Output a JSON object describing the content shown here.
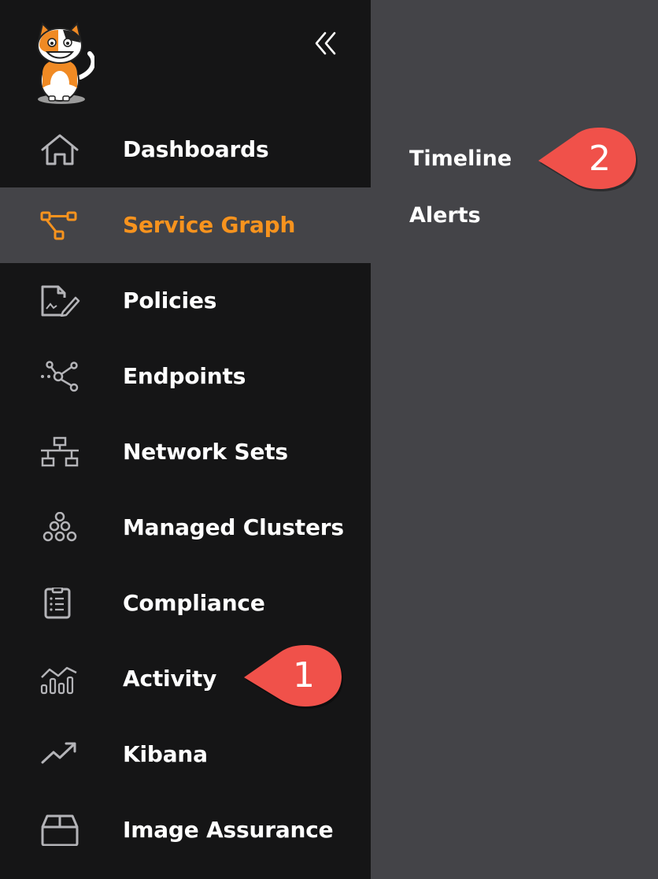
{
  "sidebar": {
    "collapse_icon": "double-chevron-left-icon",
    "logo_icon": "calico-cat-logo",
    "items": [
      {
        "label": "Dashboards",
        "icon": "home-icon"
      },
      {
        "label": "Service Graph",
        "icon": "service-graph-icon",
        "active": true
      },
      {
        "label": "Policies",
        "icon": "policy-document-icon"
      },
      {
        "label": "Endpoints",
        "icon": "endpoints-nodes-icon"
      },
      {
        "label": "Network Sets",
        "icon": "network-tree-icon"
      },
      {
        "label": "Managed Clusters",
        "icon": "clusters-icon"
      },
      {
        "label": "Compliance",
        "icon": "clipboard-icon"
      },
      {
        "label": "Activity",
        "icon": "activity-chart-icon"
      },
      {
        "label": "Kibana",
        "icon": "trend-arrow-icon"
      },
      {
        "label": "Image Assurance",
        "icon": "box-icon"
      }
    ]
  },
  "submenu": {
    "items": [
      {
        "label": "Timeline"
      },
      {
        "label": "Alerts"
      }
    ]
  },
  "callouts": [
    {
      "number": "1"
    },
    {
      "number": "2"
    }
  ],
  "colors": {
    "sidebar_bg": "#151516",
    "panel_bg": "#444448",
    "accent": "#f7931e",
    "callout": "#f0514a",
    "icon_gray": "#b4b4b8"
  }
}
